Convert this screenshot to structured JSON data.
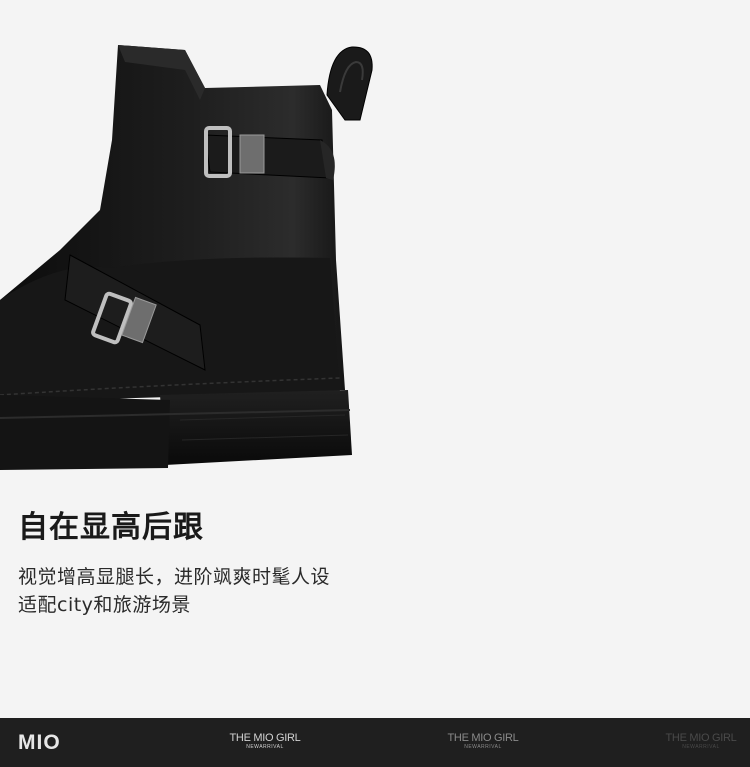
{
  "product_image": {
    "subject": "black-leather-buckle-boot"
  },
  "headline": "自在显高后跟",
  "description": {
    "line1": "视觉增高显腿长，进阶飒爽时髦人设",
    "line2": "适配city和旅游场景"
  },
  "footer": {
    "logo": "MIO",
    "taglines": [
      {
        "main": "THE MIO GIRL",
        "sub": "NEWARRIVAL"
      },
      {
        "main": "THE MIO GIRL",
        "sub": "NEWARRIVAL"
      },
      {
        "main": "THE MIO GIRL",
        "sub": "NEWARRIVAL"
      }
    ]
  },
  "colors": {
    "background": "#f4f4f4",
    "footer_bg": "#1f1f1f",
    "boot_leather": "#141414",
    "buckle_metal": "#b8b8b8"
  }
}
